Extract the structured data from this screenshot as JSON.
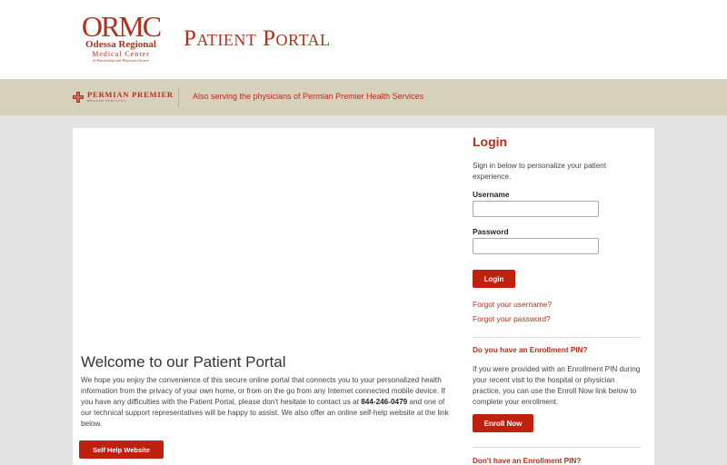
{
  "header": {
    "logo": {
      "mark": "ORMC",
      "line1": "Odessa Regional",
      "line2": "Medical Center",
      "line3": "In Partnership with Physician Owners"
    },
    "title": "Patient Portal"
  },
  "band": {
    "partner_name": "PERMIAN PREMIER",
    "partner_sub": "HEALTH SERVICES",
    "text": "Also serving the physicians of Permian Premier Health Services"
  },
  "welcome": {
    "title": "Welcome to our Patient Portal",
    "body_before_phone": "We hope you enjoy the convenience of this secure online portal that connects you to your personalized health information from the privacy of your own home, or from on the go from any Internet connected mobile device. If you have any difficulties with the Patient Portal, please don't hesitate to contact us at",
    "phone": "844-246-0479",
    "body_after_phone": "and one of our technical support representatives will be happy to assist. We also offer an online self-help website at the link below.",
    "self_help_label": "Self Help Website"
  },
  "login": {
    "title": "Login",
    "intro": "Sign in below to personalize your patient experience.",
    "username_label": "Username",
    "username_value": "",
    "password_label": "Password",
    "password_value": "",
    "button_label": "Login",
    "forgot_username": "Forgot your username?",
    "forgot_password": "Forgot your password?"
  },
  "enrollment": {
    "heading": "Do you have an Enrollment PIN?",
    "text": "If you were provided with an Enrollment PIN during your recent visit to the hospital or physician practice, you can use the Enroll Now link below to complete your enrollment.",
    "button_label": "Enroll Now"
  },
  "no_pin": {
    "heading": "Don't have an Enrollment PIN?"
  },
  "colors": {
    "brand_red": "#b0301c",
    "button_red": "#c0210f",
    "band": "#d7d1bc",
    "page_bg": "#e4e4e4"
  }
}
